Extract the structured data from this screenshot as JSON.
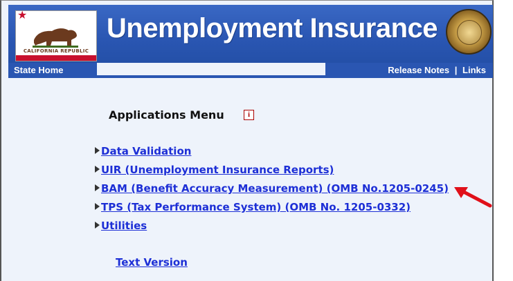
{
  "header": {
    "flag_text": "CALIFORNIA REPUBLIC",
    "title": "Unemployment Insurance"
  },
  "nav": {
    "home": "State Home",
    "release_notes": "Release Notes",
    "separator": "|",
    "links": "Links"
  },
  "menu": {
    "title": "Applications Menu",
    "info_icon": "i",
    "items": [
      {
        "label": "Data Validation"
      },
      {
        "label": "UIR (Unemployment Insurance Reports)"
      },
      {
        "label": "BAM (Benefit Accuracy Measurement) (OMB No.1205-0245)"
      },
      {
        "label": "TPS (Tax Performance System) (OMB No. 1205-0332)"
      },
      {
        "label": "Utilities"
      }
    ],
    "text_version": "Text Version"
  },
  "colors": {
    "banner_blue": "#2a56b2",
    "link_blue": "#1d2fd6",
    "annotation_red": "#e0101a",
    "page_bg": "#eef3fb"
  },
  "icons": [
    "california-flag-icon",
    "state-seal-icon",
    "info-icon",
    "triangle-bullet-icon",
    "red-annotation-arrow"
  ]
}
